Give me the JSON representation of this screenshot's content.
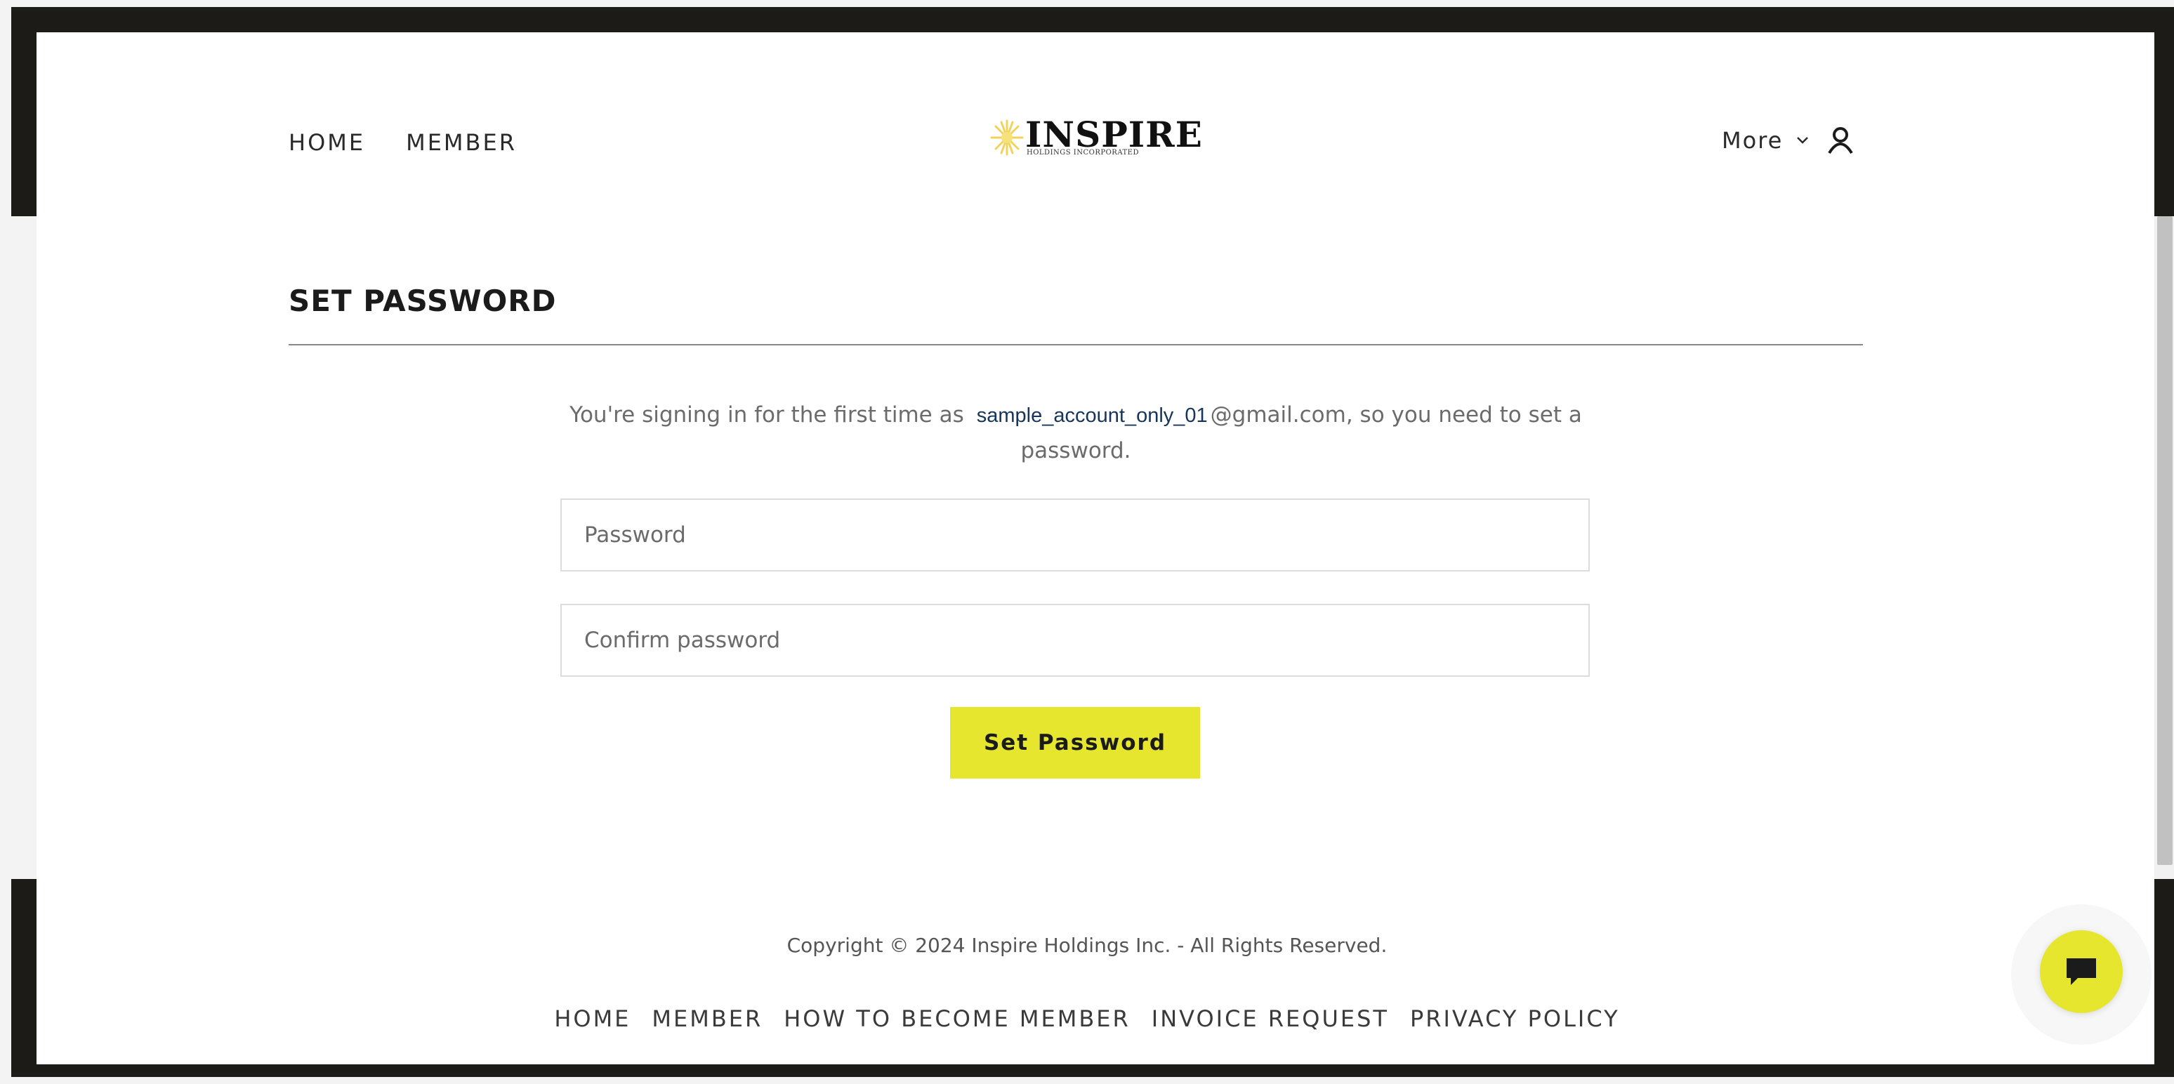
{
  "header": {
    "nav": [
      {
        "label": "HOME"
      },
      {
        "label": "MEMBER"
      }
    ],
    "logo": {
      "name": "INSPIRE",
      "tagline": "HOLDINGS INCORPORATED"
    },
    "more_label": "More",
    "icons": {
      "chevron": "chevron-down-icon",
      "account": "user-icon"
    }
  },
  "main": {
    "title": "SET PASSWORD",
    "intro": {
      "prefix": "You're signing in for the first time as",
      "email_user": "sample_account_only_01",
      "suffix": "@gmail.com, so you need to set a password."
    },
    "password_placeholder": "Password",
    "confirm_placeholder": "Confirm password",
    "submit_label": "Set Password"
  },
  "footer": {
    "copyright": "Copyright © 2024 Inspire Holdings Inc. - All Rights Reserved.",
    "links": [
      {
        "label": "HOME"
      },
      {
        "label": "MEMBER"
      },
      {
        "label": "HOW TO BECOME MEMBER"
      },
      {
        "label": "INVOICE REQUEST"
      },
      {
        "label": "PRIVACY POLICY"
      }
    ]
  },
  "chat": {
    "icon": "chat-icon"
  },
  "colors": {
    "accent": "#e6e62e",
    "frame": "#1c1b18",
    "text": "#1b1b1b"
  }
}
